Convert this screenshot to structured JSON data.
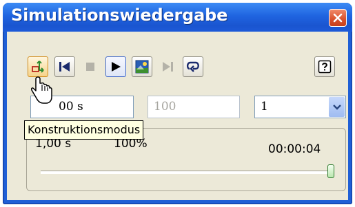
{
  "window": {
    "title": "Simulationswiedergabe",
    "close_icon": "close-icon"
  },
  "toolbar": {
    "buttons": [
      {
        "name": "construction-mode-icon",
        "state": "hover"
      },
      {
        "name": "skip-to-start-icon",
        "state": "normal"
      },
      {
        "name": "stop-icon",
        "state": "disabled"
      },
      {
        "name": "play-icon",
        "state": "pressed"
      },
      {
        "name": "record-animation-icon",
        "state": "normal"
      },
      {
        "name": "skip-to-end-icon",
        "state": "disabled"
      },
      {
        "name": "loop-icon",
        "state": "normal"
      },
      {
        "name": "help-icon",
        "state": "normal"
      }
    ]
  },
  "fields": {
    "time_value": "1,00 s",
    "time_visible": "00 s",
    "percent_value": "100",
    "step_value": "1"
  },
  "panel": {
    "current_time": "1,00 s",
    "percent": "100%",
    "end_time": "00:00:04",
    "slider_progress": 1.0
  },
  "tooltip": {
    "text": "Konstruktionsmodus"
  },
  "colors": {
    "titlebar": "#1f5fd6",
    "client_background": "#ece9d8",
    "close_button": "#d9502c",
    "tooltip_background": "#ffffe1"
  }
}
